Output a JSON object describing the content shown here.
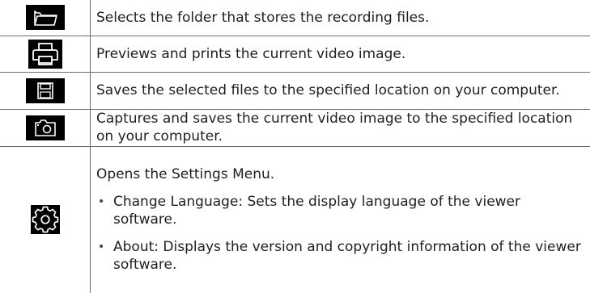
{
  "rows": [
    {
      "icon": "folder-icon",
      "text": "Selects the folder that stores the recording files."
    },
    {
      "icon": "printer-icon",
      "text": "Previews and prints the current video image."
    },
    {
      "icon": "save-disk-icon",
      "text": "Saves the selected files to the specified location on your computer."
    },
    {
      "icon": "camera-icon",
      "text": "Captures and saves the current video image to the specified location on your computer."
    },
    {
      "icon": "gear-icon",
      "text": "Opens the Settings Menu.",
      "bullets": [
        "Change Language: Sets the display language of the viewer software.",
        "About: Displays the version and copyright information of the viewer software."
      ]
    }
  ],
  "colors": {
    "icon_background": "#000000",
    "icon_stroke": "#ffffff",
    "border": "#6a6a6a",
    "text": "#1f1f1f"
  }
}
